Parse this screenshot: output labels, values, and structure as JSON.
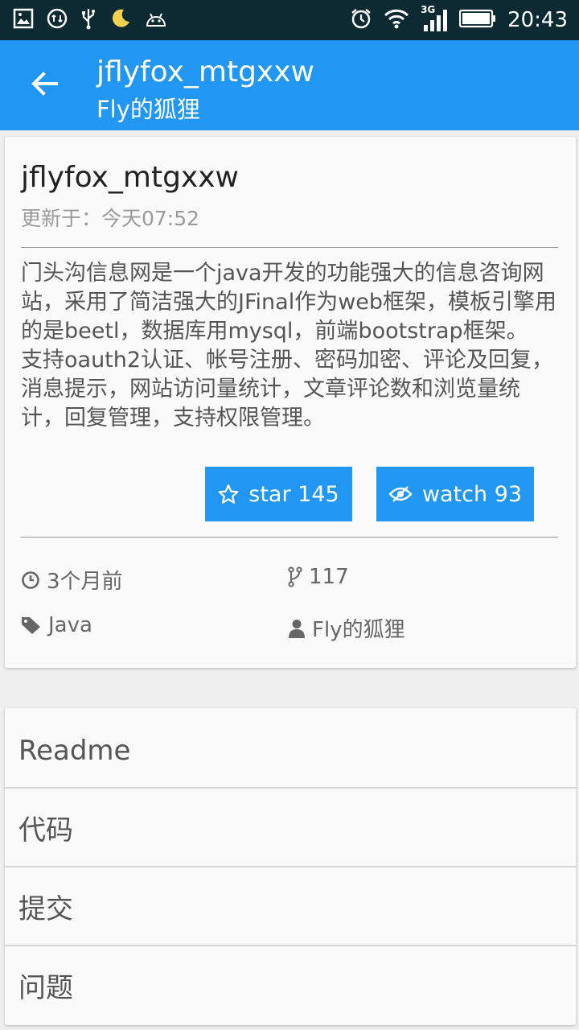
{
  "status_bar": {
    "time": "20:43",
    "network": "3G",
    "icons": [
      "image-icon",
      "sync-icon",
      "usb-icon",
      "moon-icon",
      "android-icon",
      "alarm-icon",
      "wifi-icon",
      "signal-icon",
      "battery-icon"
    ]
  },
  "app_bar": {
    "title": "jflyfox_mtgxxw",
    "subtitle": "Fly的狐狸",
    "back_icon": "arrow-back-icon"
  },
  "repo": {
    "name": "jflyfox_mtgxxw",
    "updated": "更新于：今天07:52",
    "description": "门头沟信息网是一个java开发的功能强大的信息咨询网站，采用了简洁强大的JFinal作为web框架，模板引擎用的是beetl，数据库用mysql，前端bootstrap框架。\n支持oauth2认证、帐号注册、密码加密、评论及回复，消息提示，网站访问量统计，文章评论数和浏览量统计，回复管理，支持权限管理。",
    "star_label": "star 145",
    "watch_label": "watch 93",
    "time_ago": "3个月前",
    "forks": "117",
    "language": "Java",
    "owner": "Fly的狐狸"
  },
  "menu": {
    "items": [
      "Readme",
      "代码",
      "提交",
      "问题"
    ]
  },
  "colors": {
    "primary": "#2196f3",
    "status_bar": "#0d2a33",
    "background": "#efefef",
    "card": "#fafafa"
  }
}
